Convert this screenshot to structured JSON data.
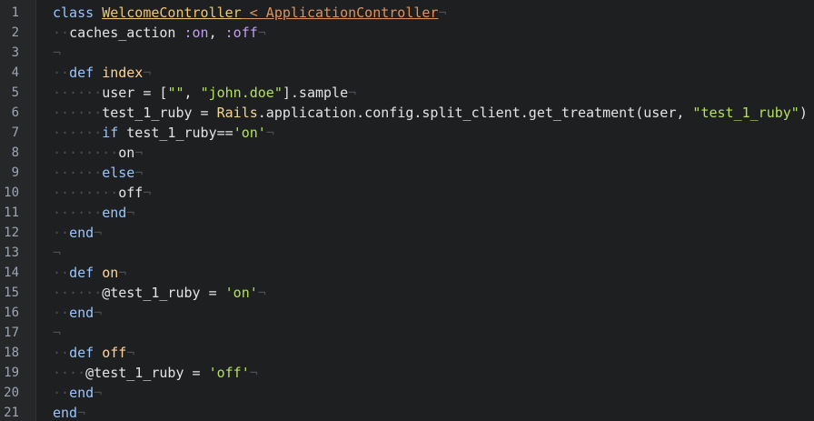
{
  "editor": {
    "lines": [
      {
        "number": "1",
        "tokens": [
          {
            "t": "class ",
            "c": "kw"
          },
          {
            "t": "WelcomeController",
            "c": "class"
          },
          {
            "t": " < ApplicationController",
            "c": "super"
          },
          {
            "t": "¬",
            "c": "eol"
          }
        ]
      },
      {
        "number": "2",
        "tokens": [
          {
            "t": "··",
            "c": "ws"
          },
          {
            "t": "caches_action ",
            "c": "plain"
          },
          {
            "t": ":on",
            "c": "sym"
          },
          {
            "t": ", ",
            "c": "plain"
          },
          {
            "t": ":off",
            "c": "sym"
          },
          {
            "t": "¬",
            "c": "eol"
          }
        ]
      },
      {
        "number": "3",
        "tokens": [
          {
            "t": "¬",
            "c": "eol"
          }
        ]
      },
      {
        "number": "4",
        "tokens": [
          {
            "t": "··",
            "c": "ws"
          },
          {
            "t": "def ",
            "c": "kw"
          },
          {
            "t": "index",
            "c": "fn"
          },
          {
            "t": "¬",
            "c": "eol"
          }
        ]
      },
      {
        "number": "5",
        "tokens": [
          {
            "t": "······",
            "c": "ws"
          },
          {
            "t": "user = [",
            "c": "plain"
          },
          {
            "t": "\"\"",
            "c": "str"
          },
          {
            "t": ", ",
            "c": "plain"
          },
          {
            "t": "\"john.doe\"",
            "c": "str"
          },
          {
            "t": "].sample",
            "c": "plain"
          },
          {
            "t": "¬",
            "c": "eol"
          }
        ]
      },
      {
        "number": "6",
        "tokens": [
          {
            "t": "······",
            "c": "ws"
          },
          {
            "t": "test_1_ruby = ",
            "c": "plain"
          },
          {
            "t": "Rails",
            "c": "const"
          },
          {
            "t": ".application.config.split_client.get_treatment(user, ",
            "c": "plain"
          },
          {
            "t": "\"test_1_ruby\"",
            "c": "str"
          },
          {
            "t": ")",
            "c": "plain"
          }
        ]
      },
      {
        "number": "7",
        "tokens": [
          {
            "t": "······",
            "c": "ws"
          },
          {
            "t": "if ",
            "c": "kw"
          },
          {
            "t": "test_1_ruby==",
            "c": "plain"
          },
          {
            "t": "'on'",
            "c": "str"
          },
          {
            "t": "¬",
            "c": "eol"
          }
        ]
      },
      {
        "number": "8",
        "tokens": [
          {
            "t": "········",
            "c": "ws"
          },
          {
            "t": "on",
            "c": "plain"
          },
          {
            "t": "¬",
            "c": "eol"
          }
        ]
      },
      {
        "number": "9",
        "tokens": [
          {
            "t": "······",
            "c": "ws"
          },
          {
            "t": "else",
            "c": "kw"
          },
          {
            "t": "¬",
            "c": "eol"
          }
        ]
      },
      {
        "number": "10",
        "tokens": [
          {
            "t": "········",
            "c": "ws"
          },
          {
            "t": "off",
            "c": "plain"
          },
          {
            "t": "¬",
            "c": "eol"
          }
        ]
      },
      {
        "number": "11",
        "tokens": [
          {
            "t": "······",
            "c": "ws"
          },
          {
            "t": "end",
            "c": "kw"
          },
          {
            "t": "¬",
            "c": "eol"
          }
        ]
      },
      {
        "number": "12",
        "tokens": [
          {
            "t": "··",
            "c": "ws"
          },
          {
            "t": "end",
            "c": "kw"
          },
          {
            "t": "¬",
            "c": "eol"
          }
        ]
      },
      {
        "number": "13",
        "tokens": [
          {
            "t": "¬",
            "c": "eol"
          }
        ]
      },
      {
        "number": "14",
        "tokens": [
          {
            "t": "··",
            "c": "ws"
          },
          {
            "t": "def ",
            "c": "kw"
          },
          {
            "t": "on",
            "c": "fn"
          },
          {
            "t": "¬",
            "c": "eol"
          }
        ]
      },
      {
        "number": "15",
        "tokens": [
          {
            "t": "······",
            "c": "ws"
          },
          {
            "t": "@test_1_ruby = ",
            "c": "ivar"
          },
          {
            "t": "'on'",
            "c": "str"
          },
          {
            "t": "¬",
            "c": "eol"
          }
        ]
      },
      {
        "number": "16",
        "tokens": [
          {
            "t": "··",
            "c": "ws"
          },
          {
            "t": "end",
            "c": "kw"
          },
          {
            "t": "¬",
            "c": "eol"
          }
        ]
      },
      {
        "number": "17",
        "tokens": [
          {
            "t": "¬",
            "c": "eol"
          }
        ]
      },
      {
        "number": "18",
        "tokens": [
          {
            "t": "··",
            "c": "ws"
          },
          {
            "t": "def ",
            "c": "kw"
          },
          {
            "t": "off",
            "c": "fn"
          },
          {
            "t": "¬",
            "c": "eol"
          }
        ]
      },
      {
        "number": "19",
        "tokens": [
          {
            "t": "····",
            "c": "ws"
          },
          {
            "t": "@test_1_ruby = ",
            "c": "ivar"
          },
          {
            "t": "'off'",
            "c": "str"
          },
          {
            "t": "¬",
            "c": "eol"
          }
        ]
      },
      {
        "number": "20",
        "tokens": [
          {
            "t": "··",
            "c": "ws"
          },
          {
            "t": "end",
            "c": "kw"
          },
          {
            "t": "¬",
            "c": "eol"
          }
        ]
      },
      {
        "number": "21",
        "tokens": [
          {
            "t": "end",
            "c": "kw"
          },
          {
            "t": "¬",
            "c": "eol"
          }
        ]
      }
    ]
  },
  "colors": {
    "background": "#1d1f21",
    "gutter": "#252729",
    "keyword": "#9ac5ff",
    "class_name": "#f0c674",
    "superclass": "#de935f",
    "symbol": "#c29df0",
    "string": "#b5e15c",
    "constant": "#f4d78a",
    "invisibles": "#4a4e54"
  }
}
